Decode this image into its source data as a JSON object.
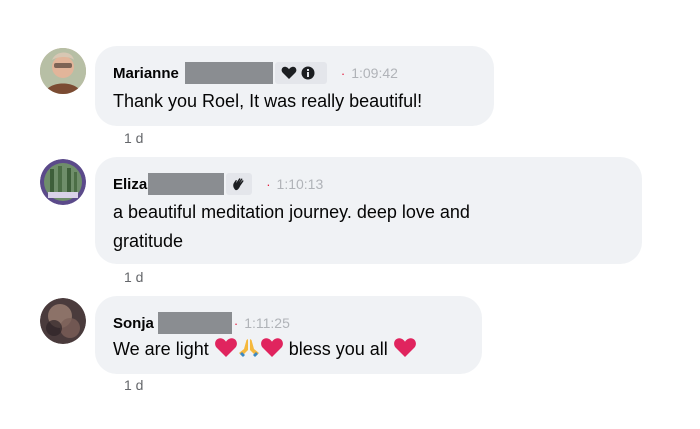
{
  "comments": [
    {
      "author": "Marianne",
      "badge_icons": [
        "heart-icon",
        "info-icon"
      ],
      "time": "1:09:42",
      "text": "Thank you Roel, It was really beautiful!",
      "age": "1 d"
    },
    {
      "author": "Eliza",
      "badge_icons": [
        "waving-hand-icon"
      ],
      "time": "1:10:13",
      "text_line1": "a beautiful meditation journey. deep love and",
      "text_line2": "gratitude",
      "age": "1 d"
    },
    {
      "author": "Sonja",
      "badge_icons": [],
      "time": "1:11:25",
      "text_part1": "We are light",
      "text_part2": "bless you all",
      "age": "1 d",
      "emojis": [
        "red-heart",
        "folded-hands",
        "red-heart",
        "red-heart"
      ]
    }
  ],
  "colors": {
    "bubble": "#f0f2f5",
    "timestamp_dot": "#e41e3f",
    "redaction": "#8a8d91",
    "heart": "#e0245e"
  }
}
